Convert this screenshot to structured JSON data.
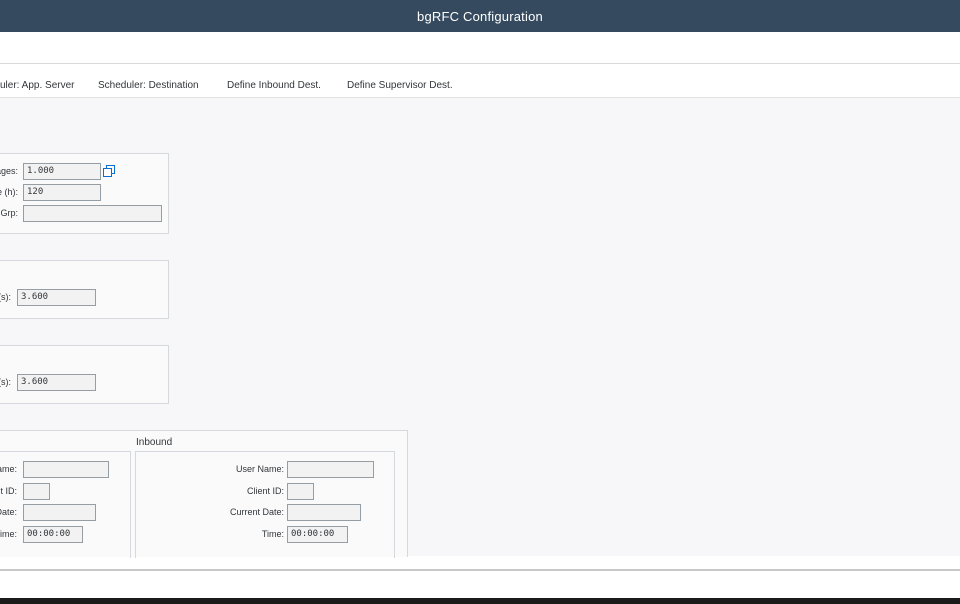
{
  "window": {
    "title": "bgRFC Configuration"
  },
  "tabs": [
    {
      "label": "uler: App. Server"
    },
    {
      "label": "Scheduler: Destination"
    },
    {
      "label": "Define Inbound Dest."
    },
    {
      "label": "Define Supervisor Dest."
    }
  ],
  "group1": {
    "row1": {
      "label": "ages:",
      "value": "1.000"
    },
    "row2": {
      "label": "e (h):",
      "value": "120"
    },
    "row3": {
      "label": "Grp:",
      "value": ""
    }
  },
  "group2": {
    "row1": {
      "label": "(s):",
      "value": "3.600"
    }
  },
  "group3": {
    "row1": {
      "label": "(s):",
      "value": "3.600"
    }
  },
  "group4": {
    "left": {
      "user": {
        "label": "ame:",
        "value": ""
      },
      "client": {
        "label": "t ID:",
        "value": ""
      },
      "date": {
        "label": "Date:",
        "value": ""
      },
      "time": {
        "label": "Time:",
        "value": "00:00:00"
      }
    },
    "inbound": {
      "title": "Inbound",
      "user": {
        "label": "User Name:",
        "value": ""
      },
      "client": {
        "label": "Client ID:",
        "value": ""
      },
      "date": {
        "label": "Current Date:",
        "value": ""
      },
      "time": {
        "label": "Time:",
        "value": "00:00:00"
      }
    }
  },
  "icons": {
    "copy": "copy-icon"
  },
  "colors": {
    "title_bar": "#354a5f",
    "content_bg": "#f7f7f9",
    "field_border": "#959da5",
    "field_bg": "#f2f2f2",
    "copy_icon": "#0a6ed1"
  }
}
